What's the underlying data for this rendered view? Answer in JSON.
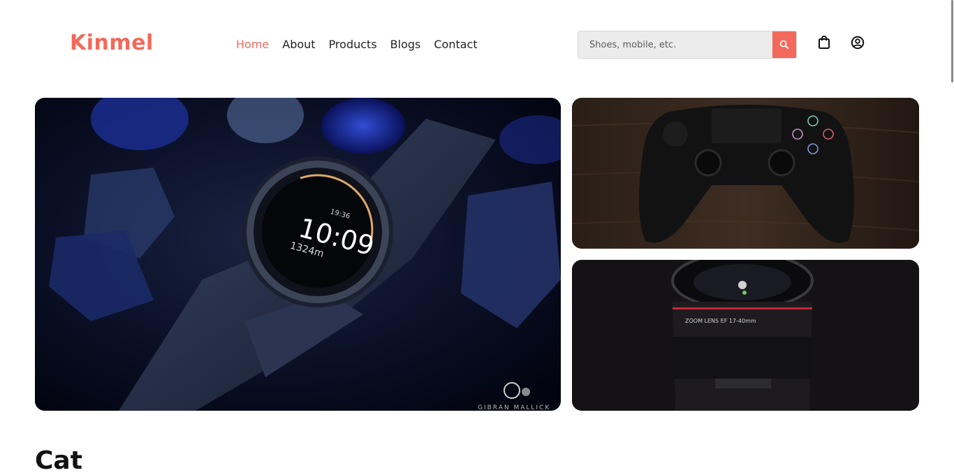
{
  "brand": {
    "name": "Kinmel",
    "color": "#f2695b"
  },
  "nav": {
    "items": [
      {
        "label": "Home",
        "active": true
      },
      {
        "label": "About",
        "active": false
      },
      {
        "label": "Products",
        "active": false
      },
      {
        "label": "Blogs",
        "active": false
      },
      {
        "label": "Contact",
        "active": false
      }
    ]
  },
  "search": {
    "value": "",
    "placeholder": "Shoes, mobile, etc.",
    "icon": "search-icon"
  },
  "header_icons": {
    "cart": "shopping-bag-icon",
    "account": "user-circle-icon"
  },
  "banners": {
    "main": {
      "subject": "smartwatch",
      "watermark": "GIBRAN MALLICK"
    },
    "top": {
      "subject": "game-controller"
    },
    "bottom": {
      "subject": "camera-lens"
    }
  },
  "section": {
    "title": "Cat"
  },
  "colors": {
    "accent": "#f2695b",
    "text": "#222222"
  }
}
